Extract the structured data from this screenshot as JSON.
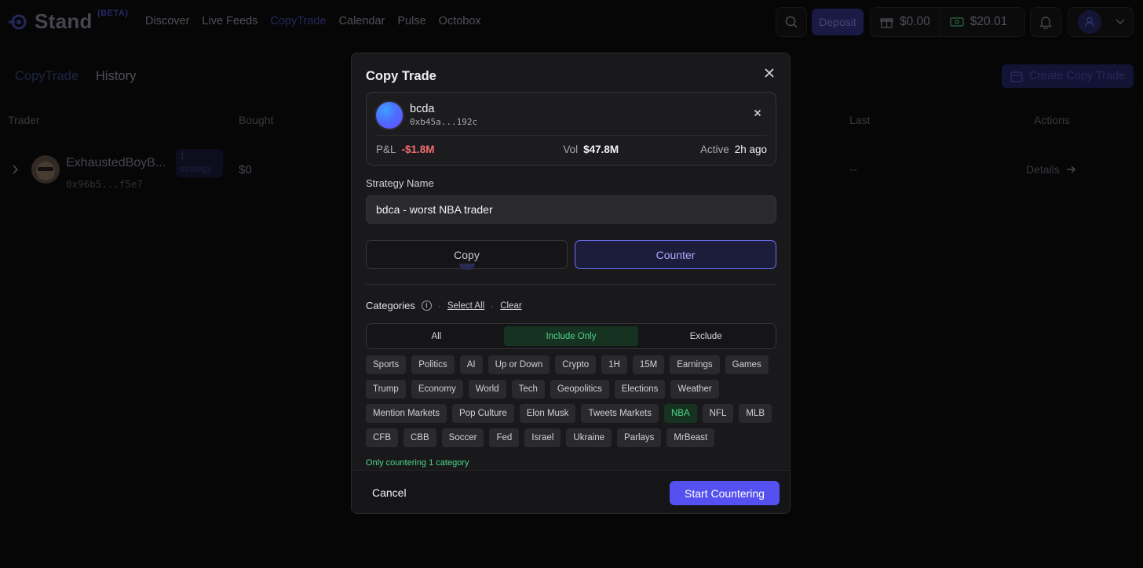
{
  "app": {
    "logo_text": "Stand",
    "beta_label": "(BETA)",
    "nav": [
      "Discover",
      "Live Feeds",
      "CopyTrade",
      "Calendar",
      "Pulse",
      "Octobox"
    ],
    "deposit_label": "Deposit",
    "balance_1": "$0.00",
    "balance_2": "$20.01"
  },
  "page": {
    "tabs": [
      "CopyTrade",
      "History"
    ],
    "create_button": "Create Copy Trade",
    "columns": {
      "trader": "Trader",
      "bought": "Bought",
      "last": "Last",
      "actions": "Actions"
    },
    "row": {
      "name": "ExhaustedBoyB...",
      "address": "0x96b5...f5e7",
      "badge": "1 strategy",
      "bought": "$0",
      "last": "--",
      "details": "Details"
    }
  },
  "modal": {
    "title": "Copy Trade",
    "trader": {
      "name": "bcda",
      "address": "0xb45a...192c",
      "pnl_label": "P&L",
      "pnl_value": "-$1.8M",
      "vol_label": "Vol",
      "vol_value": "$47.8M",
      "active_label": "Active",
      "active_value": "2h ago"
    },
    "strategy_label": "Strategy Name",
    "strategy_value": "bdca - worst NBA trader",
    "mode_copy": "Copy",
    "mode_counter": "Counter",
    "categories_label": "Categories",
    "select_all": "Select All",
    "clear": "Clear",
    "filter_tabs": [
      "All",
      "Include Only",
      "Exclude"
    ],
    "chips": [
      "Sports",
      "Politics",
      "AI",
      "Up or Down",
      "Crypto",
      "1H",
      "15M",
      "Earnings",
      "Games",
      "Trump",
      "Economy",
      "World",
      "Tech",
      "Geopolitics",
      "Elections",
      "Weather",
      "Mention Markets",
      "Pop Culture",
      "Elon Musk",
      "Tweets Markets",
      "NBA",
      "NFL",
      "MLB",
      "CFB",
      "CBB",
      "Soccer",
      "Fed",
      "Israel",
      "Ukraine",
      "Parlays",
      "MrBeast"
    ],
    "selected_chip": "NBA",
    "status_note": "Only countering 1 category",
    "cancel": "Cancel",
    "start": "Start Countering"
  },
  "colors": {
    "accent": "#5551f0",
    "positive": "#4ed688",
    "negative": "#f26d6d"
  }
}
